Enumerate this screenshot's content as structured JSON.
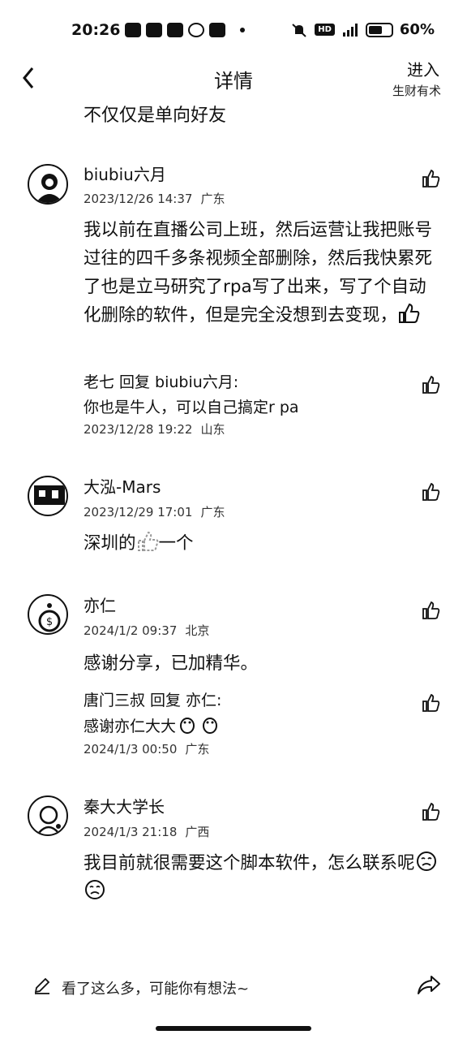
{
  "status": {
    "time": "20:26",
    "battery": "60%"
  },
  "nav": {
    "title": "详情",
    "enter_label": "进入",
    "community": "生财有术"
  },
  "top_cut_text": "不仅仅是单向好友",
  "comments": [
    {
      "author": "biubiu六月",
      "time": "2023/12/26 14:37",
      "location": "广东",
      "text": "我以前在直播公司上班，然后运营让我把账号过往的四千多条视频全部删除，然后我快累死了也是立马研究了rpa写了出来，写了个自动化删除的软件，但是完全没想到去变现，",
      "reply": {
        "from": "老七",
        "reply_word": "回复",
        "to": "biubiu六月:",
        "text": "你也是牛人，可以自己搞定r pa",
        "time": "2023/12/28 19:22",
        "location": "山东"
      }
    },
    {
      "author": "大泓-Mars",
      "time": "2023/12/29 17:01",
      "location": "广东",
      "text_before": "深圳的",
      "text_after": "一个"
    },
    {
      "author": "亦仁",
      "time": "2024/1/2 09:37",
      "location": "北京",
      "text": "感谢分享，已加精华。",
      "reply": {
        "from": "唐门三叔",
        "reply_word": "回复",
        "to": "亦仁:",
        "text": "感谢亦仁大大",
        "time": "2024/1/3 00:50",
        "location": "广东"
      }
    },
    {
      "author": "秦大大学长",
      "time": "2024/1/3 21:18",
      "location": "广西",
      "text": "我目前就很需要这个脚本软件，怎么联系呢"
    }
  ],
  "bottom": {
    "input_placeholder": "看了这么多，可能你有想法~"
  }
}
